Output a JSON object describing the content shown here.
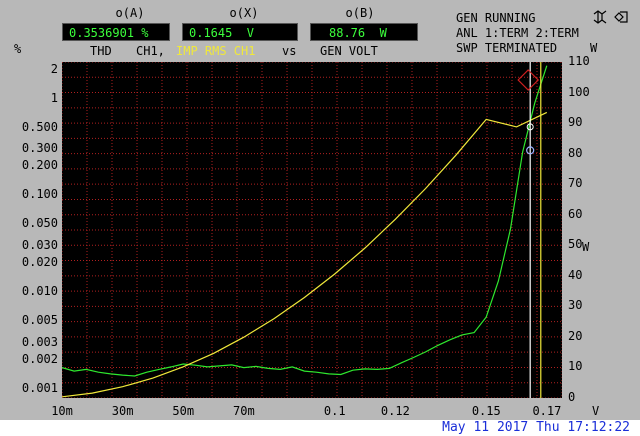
{
  "readouts": {
    "a": {
      "label": "o(A)",
      "value": "0.3536901 %"
    },
    "x": {
      "label": "o(X)",
      "value": "0.1645  V"
    },
    "b": {
      "label": "o(B)",
      "value": "88.76  W"
    }
  },
  "status": {
    "line1": "GEN RUNNING",
    "line2": "ANL 1:TERM 2:TERM",
    "line3": "SWP TERMINATED"
  },
  "legend": {
    "thd": "THD",
    "ch1": "CH1,",
    "imp": "IMP RMS CH1",
    "vs": "vs",
    "gen": "GEN VOLT"
  },
  "units": {
    "left_top": "%",
    "right_unit": "W",
    "right_axis_unit": "W",
    "x_unit": "V"
  },
  "footer": {
    "timestamp": "May 11 2017 Thu 17:12:22"
  },
  "icons": {
    "top_right": "mute-icon"
  },
  "colors": {
    "background": "#b8b8b8",
    "plot_bg": "#000000",
    "grid": "#b02020",
    "green": "#2ee82e",
    "yellow": "#f0e83a",
    "readout": "#3cff3c",
    "footer": "#1a2ed8"
  },
  "chart_data": {
    "type": "line",
    "xlabel": "",
    "x_tick_labels": [
      "10m",
      "30m",
      "50m",
      "70m",
      "0.1",
      "0.12",
      "0.15",
      "0.17"
    ],
    "x_ticks": [
      0.01,
      0.03,
      0.05,
      0.07,
      0.1,
      0.12,
      0.15,
      0.17
    ],
    "xlim": [
      0.01,
      0.175
    ],
    "y_left": {
      "scale": "log",
      "lim": [
        0.0008,
        2.4
      ],
      "tick_labels": [
        "2",
        "1",
        "0.500",
        "0.300",
        "0.200",
        "0.100",
        "0.050",
        "0.030",
        "0.020",
        "0.010",
        "0.005",
        "0.003",
        "0.002",
        "0.001"
      ],
      "ticks": [
        2,
        1,
        0.5,
        0.3,
        0.2,
        0.1,
        0.05,
        0.03,
        0.02,
        0.01,
        0.005,
        0.003,
        0.002,
        0.001
      ],
      "unit": "%"
    },
    "y_right": {
      "scale": "linear",
      "lim": [
        0,
        110
      ],
      "tick_labels": [
        "110",
        "100",
        "90",
        "80",
        "70",
        "60",
        "50",
        "40",
        "30",
        "20",
        "10",
        "0"
      ],
      "ticks": [
        110,
        100,
        90,
        80,
        70,
        60,
        50,
        40,
        30,
        20,
        10,
        0
      ],
      "unit": "W"
    },
    "series": [
      {
        "name": "THD",
        "axis": "left",
        "color": "#2ee82e",
        "x": [
          0.01,
          0.014,
          0.018,
          0.022,
          0.026,
          0.03,
          0.034,
          0.038,
          0.042,
          0.046,
          0.05,
          0.054,
          0.058,
          0.062,
          0.066,
          0.07,
          0.074,
          0.078,
          0.082,
          0.086,
          0.09,
          0.094,
          0.098,
          0.102,
          0.106,
          0.11,
          0.114,
          0.118,
          0.122,
          0.126,
          0.13,
          0.134,
          0.138,
          0.142,
          0.146,
          0.15,
          0.154,
          0.158,
          0.162,
          0.166,
          0.17
        ],
        "y": [
          0.00165,
          0.00152,
          0.00158,
          0.00148,
          0.00142,
          0.00138,
          0.00135,
          0.00148,
          0.00158,
          0.00168,
          0.0018,
          0.00175,
          0.00168,
          0.00172,
          0.00176,
          0.00165,
          0.0017,
          0.00162,
          0.00158,
          0.00168,
          0.00152,
          0.00148,
          0.00142,
          0.0014,
          0.00155,
          0.0016,
          0.00158,
          0.00162,
          0.00185,
          0.0021,
          0.0024,
          0.0028,
          0.0032,
          0.0036,
          0.0038,
          0.0055,
          0.013,
          0.045,
          0.28,
          0.9,
          2.2
        ]
      },
      {
        "name": "IMP RMS CH1",
        "axis": "right",
        "color": "#f0e83a",
        "x": [
          0.01,
          0.02,
          0.03,
          0.04,
          0.05,
          0.06,
          0.07,
          0.08,
          0.09,
          0.1,
          0.11,
          0.12,
          0.13,
          0.14,
          0.15,
          0.16,
          0.17
        ],
        "y": [
          0.4,
          1.6,
          3.7,
          6.5,
          10.2,
          14.6,
          19.9,
          26,
          32.9,
          40.6,
          49.1,
          58.5,
          68.6,
          79.5,
          91.2,
          88.76,
          93.5
        ]
      }
    ],
    "cursor": {
      "x": 0.1645,
      "y_left": 0.3536901,
      "y_right": 88.76
    },
    "grid": true
  }
}
